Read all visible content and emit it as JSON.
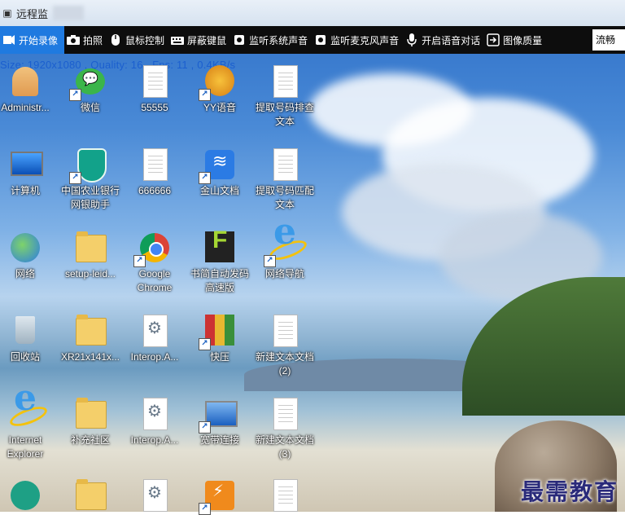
{
  "window": {
    "title": "远程监",
    "icon": "app-icon"
  },
  "toolbar": {
    "items": [
      {
        "label": "开始录像",
        "icon": "record-icon",
        "active": true
      },
      {
        "label": "拍照",
        "icon": "camera-icon"
      },
      {
        "label": "鼠标控制",
        "icon": "mouse-icon"
      },
      {
        "label": "屏蔽键鼠",
        "icon": "keyboard-icon"
      },
      {
        "label": "监听系统声音",
        "icon": "speaker-icon"
      },
      {
        "label": "监听麦克风声音",
        "icon": "speaker-icon"
      },
      {
        "label": "开启语音对话",
        "icon": "microphone-icon"
      },
      {
        "label": "图像质量",
        "icon": "quality-icon"
      }
    ],
    "quality_value": "流畅"
  },
  "status": "Size: 1920x1080 , Quality: 16 , Fps: 11 , 0.4KB/s",
  "desktop": {
    "icons": [
      {
        "label": "Administr...",
        "type": "user",
        "shortcut": false
      },
      {
        "label": "微信",
        "type": "wechat",
        "shortcut": true
      },
      {
        "label": "55555",
        "type": "doc",
        "shortcut": false
      },
      {
        "label": "YY语音",
        "type": "yy",
        "shortcut": true
      },
      {
        "label": "提取号码排查文本",
        "type": "doc",
        "shortcut": false
      },
      {
        "label": "计算机",
        "type": "pc",
        "shortcut": false
      },
      {
        "label": "中国农业银行网银助手",
        "type": "shield",
        "shortcut": true
      },
      {
        "label": "666666",
        "type": "doc",
        "shortcut": false
      },
      {
        "label": "金山文档",
        "type": "wps",
        "shortcut": true
      },
      {
        "label": "提取号码匹配文本",
        "type": "doc",
        "shortcut": false
      },
      {
        "label": "网络",
        "type": "net",
        "shortcut": false
      },
      {
        "label": "setup-leid...",
        "type": "folder",
        "shortcut": false
      },
      {
        "label": "Google Chrome",
        "type": "chrome",
        "shortcut": true
      },
      {
        "label": "书简自动发码高速版",
        "type": "f",
        "shortcut": false
      },
      {
        "label": "网络导航",
        "type": "ie",
        "shortcut": true
      },
      {
        "label": "回收站",
        "type": "bin",
        "shortcut": false
      },
      {
        "label": "XR21x141x...",
        "type": "folder",
        "shortcut": false
      },
      {
        "label": "Interop.A...",
        "type": "gear",
        "shortcut": false
      },
      {
        "label": "快压",
        "type": "rar",
        "shortcut": true
      },
      {
        "label": "新建文本文档(2)",
        "type": "doc",
        "shortcut": false
      },
      {
        "label": "Internet Explorer",
        "type": "ie",
        "shortcut": false
      },
      {
        "label": "补充社区",
        "type": "folder",
        "shortcut": false
      },
      {
        "label": "Interop.A...",
        "type": "gear",
        "shortcut": false
      },
      {
        "label": "宽带连接",
        "type": "broad",
        "shortcut": true
      },
      {
        "label": "新建文本文档(3)",
        "type": "doc",
        "shortcut": false
      },
      {
        "label": "",
        "type": "dice",
        "shortcut": false
      },
      {
        "label": "",
        "type": "folder",
        "shortcut": false
      },
      {
        "label": "",
        "type": "gear",
        "shortcut": false
      },
      {
        "label": "",
        "type": "flash",
        "shortcut": true
      },
      {
        "label": "",
        "type": "doc",
        "shortcut": false
      }
    ]
  },
  "watermark": "最需教育"
}
